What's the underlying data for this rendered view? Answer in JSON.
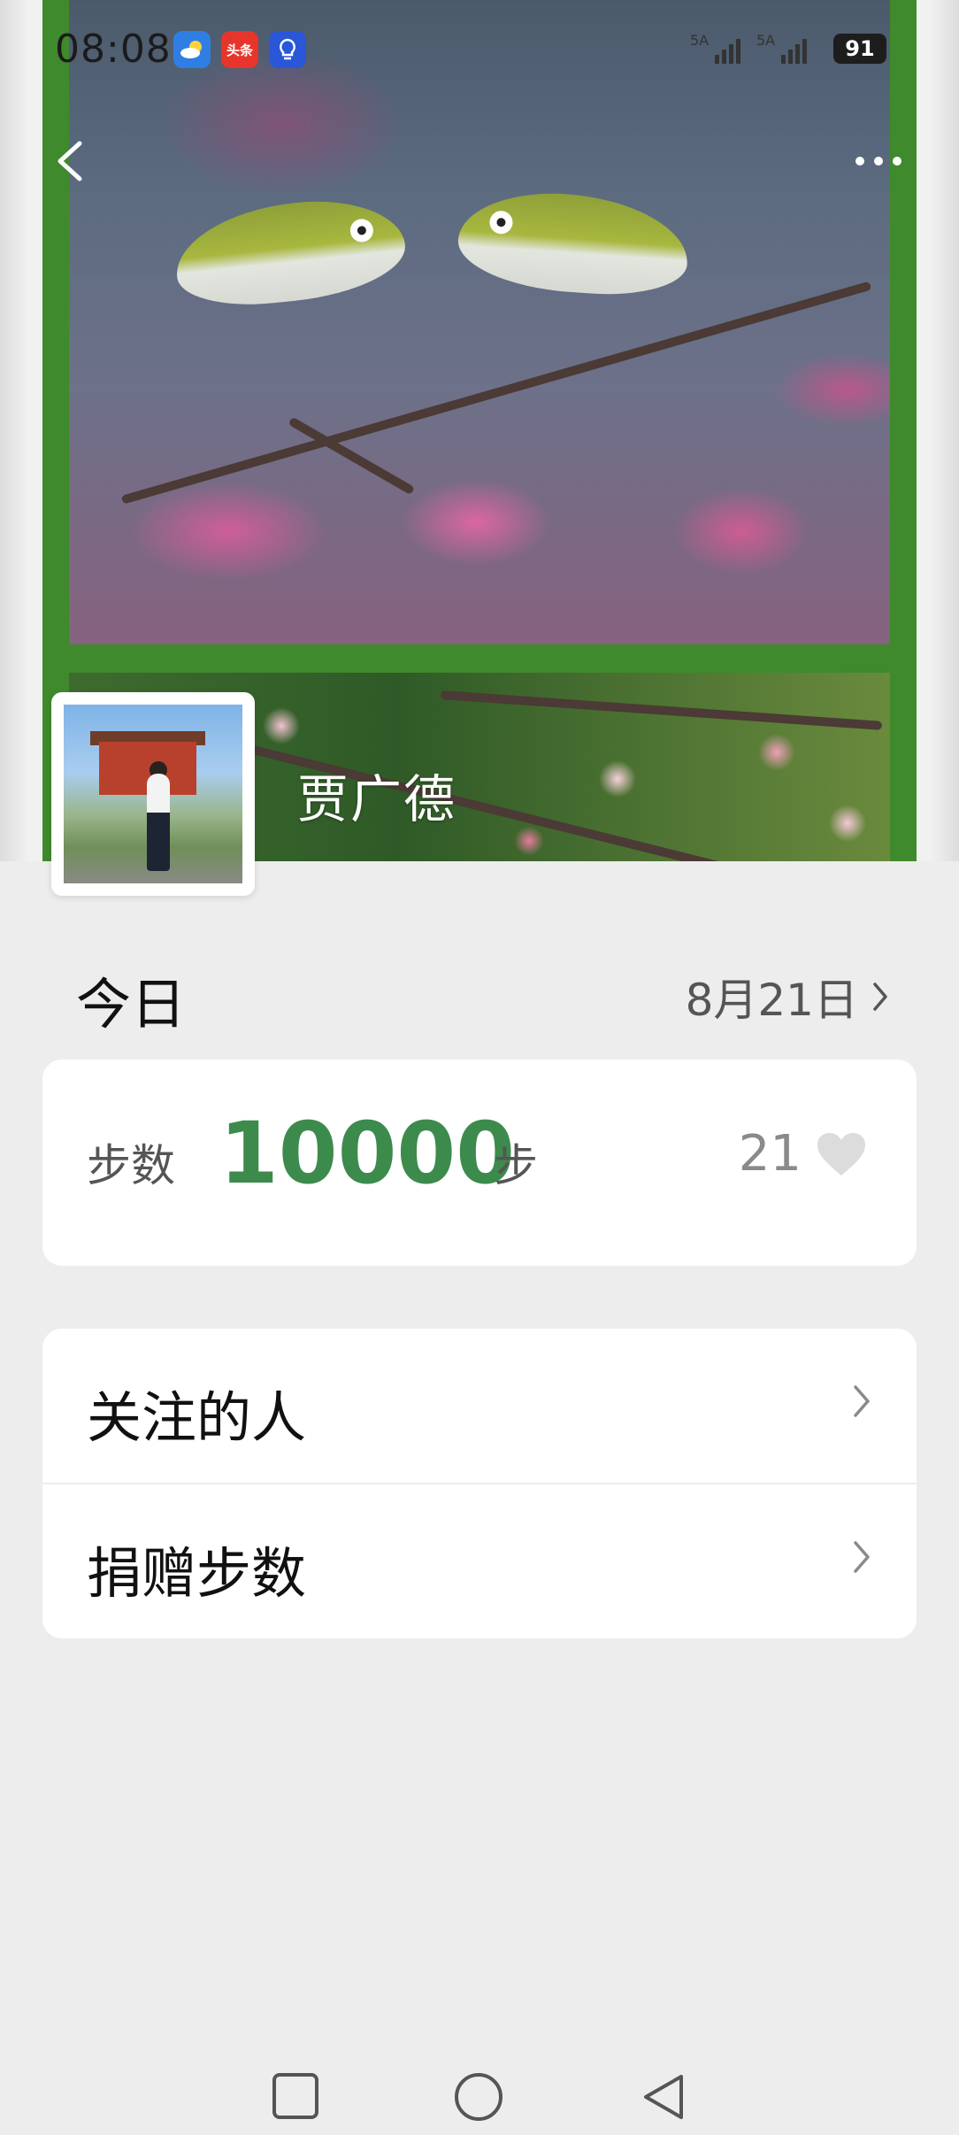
{
  "status_bar": {
    "time": "08:08",
    "app_icons": [
      "weather-icon",
      "toutiao-icon",
      "bulb-icon"
    ],
    "toutiao_label": "头条",
    "sim1_label": "5A",
    "sim2_label": "5A",
    "battery": "91"
  },
  "profile": {
    "name": "贾广德"
  },
  "today": {
    "title": "今日",
    "date": "8月21日",
    "steps_label": "步数",
    "steps_value": "10000",
    "steps_unit": "步",
    "likes": "21"
  },
  "menu": {
    "items": [
      {
        "label": "关注的人"
      },
      {
        "label": "捐赠步数"
      }
    ]
  },
  "colors": {
    "accent": "#3d8a4d",
    "background": "#ededed",
    "card": "#ffffff",
    "cover_frame": "#3f8a2c"
  }
}
